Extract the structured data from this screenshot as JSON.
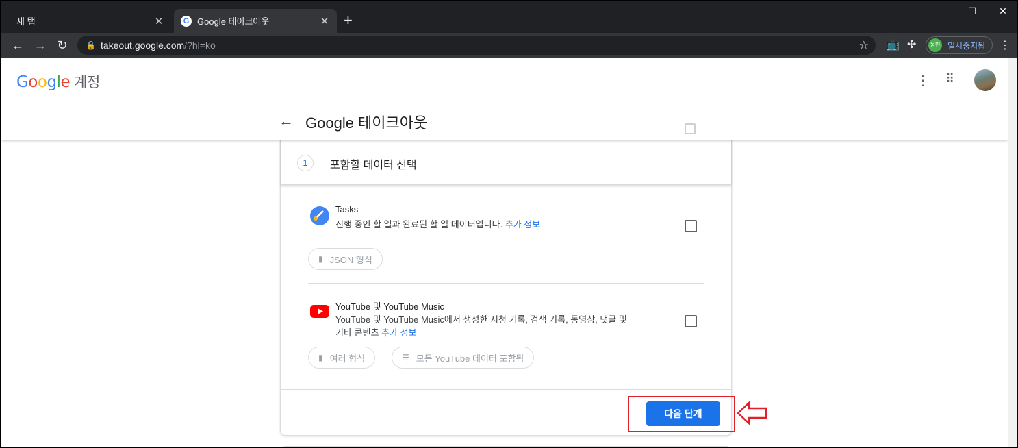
{
  "browser": {
    "tabs": [
      {
        "label": "새 탭",
        "active": false
      },
      {
        "label": "Google 테이크아웃",
        "active": true
      }
    ],
    "new_tab_icon": "plus-icon",
    "url_host": "takeout.google.com",
    "url_path": "/?hl=ko",
    "profile_avatar_text": "동민",
    "profile_label": "일시중지됨"
  },
  "header": {
    "logo": "Google",
    "logo_suffix": "계정",
    "title": "Google 테이크아웃"
  },
  "step": {
    "number": "1",
    "label": "포함할 데이터 선택"
  },
  "products": [
    {
      "name": "Tasks",
      "description": "진행 중인 할 일과 완료된 할 일 데이터입니다.",
      "link": "추가 정보",
      "checked": false,
      "chips": [
        {
          "label": "JSON 형식",
          "icon": "file-icon"
        }
      ]
    },
    {
      "name": "YouTube 및 YouTube Music",
      "description_line1": "YouTube 및 YouTube Music에서 생성한 시청 기록, 검색 기록, 동영상, 댓글 및",
      "description_line2": "기타 콘텐츠",
      "link": "추가 정보",
      "checked": false,
      "chips": [
        {
          "label": "여러 형식",
          "icon": "file-icon"
        },
        {
          "label": "모든 YouTube 데이터 포함됨",
          "icon": "list-icon"
        }
      ]
    }
  ],
  "next_button": "다음 단계",
  "colors": {
    "accent": "#1a73e8",
    "annotation": "#e0202a"
  }
}
